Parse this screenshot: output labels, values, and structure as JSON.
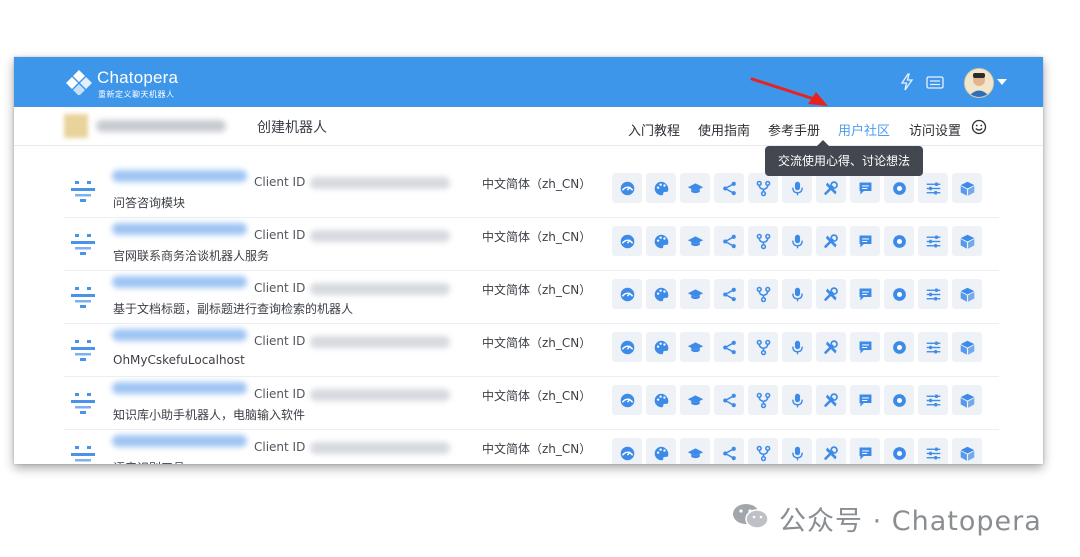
{
  "app": {
    "name": "Chatopera",
    "tagline": "重新定义聊天机器人"
  },
  "colors": {
    "header_bg": "#3d96ea",
    "accent": "#3d8be8",
    "action_bg": "#eef1f5",
    "tooltip_bg": "#434850",
    "arrow": "#e8231f"
  },
  "header": {
    "icons": [
      "lightning-icon",
      "keyboard-icon",
      "user-avatar",
      "chevron-down-icon"
    ]
  },
  "subbar": {
    "create_label": "创建机器人",
    "nav": [
      {
        "label": "入门教程",
        "active": false
      },
      {
        "label": "使用指南",
        "active": false
      },
      {
        "label": "参考手册",
        "active": false
      },
      {
        "label": "用户社区",
        "active": true
      },
      {
        "label": "访问设置",
        "active": false
      }
    ],
    "tooltip": "交流使用心得、讨论想法"
  },
  "table": {
    "client_label": "Client ID",
    "rows": [
      {
        "desc": "问答咨询模块",
        "lang": "中文简体（zh_CN）"
      },
      {
        "desc": "官网联系商务洽谈机器人服务",
        "lang": "中文简体（zh_CN）"
      },
      {
        "desc": "基于文档标题，副标题进行查询检索的机器人",
        "lang": "中文简体（zh_CN）"
      },
      {
        "desc": "OhMyCskefuLocalhost",
        "lang": "中文简体（zh_CN）"
      },
      {
        "desc": "知识库小助手机器人，电脑输入软件",
        "lang": "中文简体（zh_CN）"
      },
      {
        "desc": "语音识别工具",
        "lang": "中文简体（zh_CN）"
      }
    ],
    "action_icons": [
      "dashboard-icon",
      "palette-icon",
      "graduation-cap-icon",
      "share-icon",
      "fork-icon",
      "microphone-icon",
      "tools-icon",
      "chat-icon",
      "settings-gear-icon",
      "sliders-icon",
      "cube-icon"
    ]
  },
  "watermark": {
    "text": "公众号 · Chatopera"
  }
}
